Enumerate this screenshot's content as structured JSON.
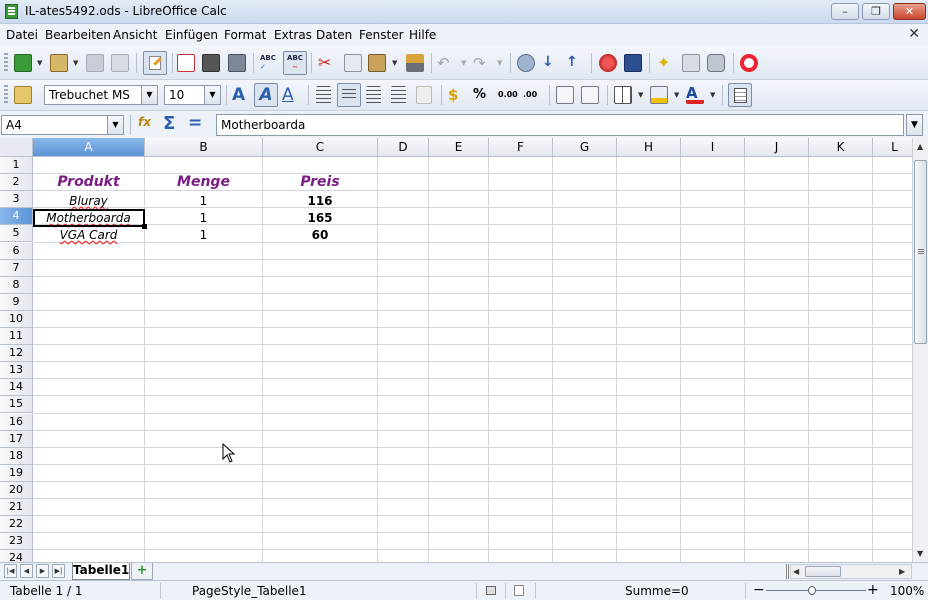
{
  "window": {
    "title": "IL-ates5492.ods - LibreOffice Calc",
    "minimize_label": "–",
    "maximize_label": "❐",
    "close_label": "✕"
  },
  "menu": {
    "items": [
      "Datei",
      "Bearbeiten",
      "Ansicht",
      "Einfügen",
      "Format",
      "Extras",
      "Daten",
      "Fenster",
      "Hilfe"
    ],
    "close_doc": "✕"
  },
  "formatting": {
    "font_name": "Trebuchet MS",
    "font_size": "10"
  },
  "formula_bar": {
    "cell_reference": "A4",
    "content": "Motherboarda"
  },
  "sheet": {
    "columns": [
      "A",
      "B",
      "C",
      "D",
      "E",
      "F",
      "G",
      "H",
      "I",
      "J",
      "K",
      "L"
    ],
    "active_column": "A",
    "rows": [
      "1",
      "2",
      "3",
      "4",
      "5",
      "6",
      "7",
      "8",
      "9",
      "10",
      "11",
      "12",
      "13",
      "14",
      "15",
      "16",
      "17",
      "18",
      "19",
      "20",
      "21",
      "22",
      "23",
      "24"
    ],
    "active_row": "4",
    "header_row": {
      "produkt": "Produkt",
      "menge": "Menge",
      "preis": "Preis"
    },
    "data_rows": [
      {
        "produkt": "Bluray",
        "menge": "1",
        "preis": "116"
      },
      {
        "produkt": "Motherboarda",
        "menge": "1",
        "preis": "165"
      },
      {
        "produkt": "VGA Card",
        "menge": "1",
        "preis": "60"
      }
    ],
    "header_color": "#7b1e84"
  },
  "tabs": {
    "active_tab": "Tabelle1",
    "add_tab": "+"
  },
  "status": {
    "sheet_position": "Tabelle 1 / 1",
    "page_style": "PageStyle_Tabelle1",
    "sum": "Summe=0",
    "zoom_minus": "−",
    "zoom_plus": "+",
    "zoom": "100%"
  },
  "icons": {
    "app": "calc-document-icon",
    "colors": {
      "accent": "#5b93d6",
      "close": "#c8442c"
    }
  }
}
